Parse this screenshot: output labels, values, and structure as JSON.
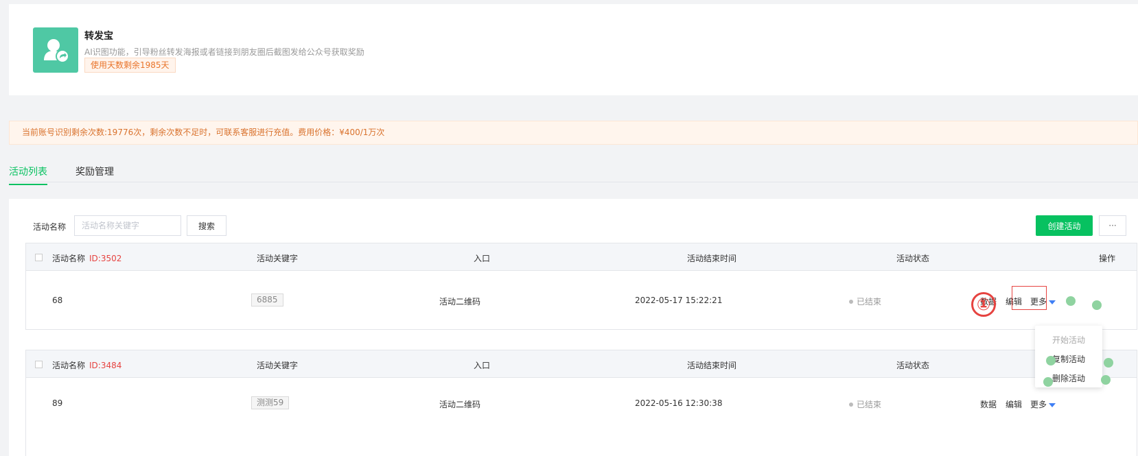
{
  "app": {
    "title": "转发宝",
    "description": "AI识图功能，引导粉丝转发海报或者链接到朋友圈后截图发给公众号获取奖励",
    "badge": "使用天数剩余1985天",
    "logo_icon": "user-share-icon",
    "logo_color": "#4fc8a4"
  },
  "notice": {
    "text": "当前账号识别剩余次数:19776次，剩余次数不足时，可联系客服进行充值。费用价格：¥400/1万次"
  },
  "tabs": [
    {
      "label": "活动列表",
      "active": true
    },
    {
      "label": "奖励管理",
      "active": false
    }
  ],
  "filter": {
    "label": "活动名称",
    "placeholder": "活动名称关键字",
    "value": "",
    "search_label": "搜索",
    "create_label": "创建活动",
    "more_label": "···"
  },
  "table": {
    "headers": {
      "name": "活动名称",
      "keyword": "活动关键字",
      "entry": "入口",
      "end_time": "活动结束时间",
      "status": "活动状态",
      "ops": "操作"
    },
    "rows": [
      {
        "id": "ID:3502",
        "name": "68",
        "keyword": "6885",
        "entry": "活动二维码",
        "end_time": "2022-05-17 15:22:21",
        "status": "已结束",
        "op_data": "数据",
        "op_edit": "编辑",
        "op_more": "更多"
      },
      {
        "id": "ID:3484",
        "name": "89",
        "keyword": "测测59",
        "entry": "活动二维码",
        "end_time": "2022-05-16 12:30:38",
        "status": "已结束",
        "op_data": "数据",
        "op_edit": "编辑",
        "op_more": "更多"
      }
    ]
  },
  "dropdown": {
    "items": [
      "开始活动",
      "复制活动",
      "删除活动"
    ]
  },
  "annotation": {
    "number": "①",
    "color": "#e64340"
  },
  "colors": {
    "primary": "#07c160",
    "link": "#3f7ff5",
    "danger": "#e64340",
    "notice_bg": "#fff5ed"
  }
}
